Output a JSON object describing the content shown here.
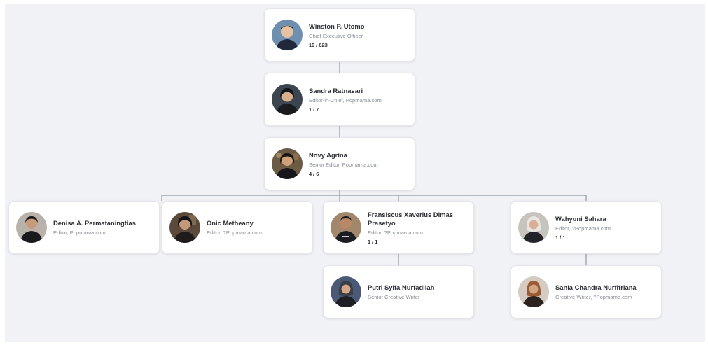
{
  "nodes": [
    {
      "name": "Winston P. Utomo",
      "title": "Chief Executive Officer",
      "count": "19 / 623",
      "avatar": "avatar-photo-winston",
      "bg": "#6f8fb0"
    },
    {
      "name": "Sandra Ratnasari",
      "title": "Editor-in-Chief, Popmama.com",
      "count": "1 / 7",
      "avatar": "avatar-photo-sandra",
      "bg": "#3d4550"
    },
    {
      "name": "Novy Agrina",
      "title": "Senior Editor, Popmama.com",
      "count": "4 / 6",
      "avatar": "avatar-photo-novy",
      "bg": "#6b5a44"
    },
    {
      "name": "Denisa A. Permataningtias",
      "title": "Editor, Popmama.com",
      "count": "",
      "avatar": "avatar-photo-denisa",
      "bg": "#b9b2aa"
    },
    {
      "name": "Onic Metheany",
      "title": "Editor, ?Popmama.com",
      "count": "",
      "avatar": "avatar-photo-onic",
      "bg": "#5b4a3c"
    },
    {
      "name": "Fransiscus Xaverius Dimas Prasetyo",
      "title": "Editor, ?Popmama.com",
      "count": "1 / 1",
      "avatar": "avatar-photo-fransiscus",
      "bg": "#a2876d"
    },
    {
      "name": "Wahyuni Sahara",
      "title": "Editor, ?Popmama.com",
      "count": "1 / 1",
      "avatar": "avatar-photo-wahyuni",
      "bg": "#c7c3bd"
    },
    {
      "name": "Putri Syifa Nurfadilah",
      "title": "Senior Creative Writer",
      "count": "",
      "avatar": "avatar-photo-putri",
      "bg": "#4a5a76"
    },
    {
      "name": "Sania Chandra Nurfitriana",
      "title": "Creative Writer, ?Popmama.com",
      "count": "",
      "avatar": "avatar-photo-sania",
      "bg": "#d4ccc2"
    }
  ],
  "colors": {
    "canvas": "#f1f2f5",
    "card": "#ffffff",
    "connector": "#8f98a3",
    "name": "#2c2f36",
    "title": "#8a9099"
  }
}
